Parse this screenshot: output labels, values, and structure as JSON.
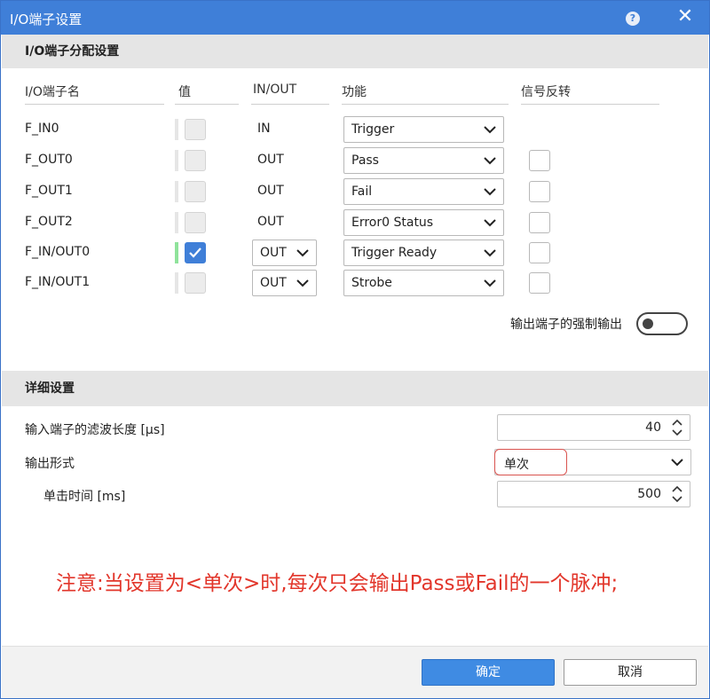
{
  "window": {
    "title": "I/O端子设置",
    "help_icon": "question-icon",
    "close_icon": "close-icon"
  },
  "section1": {
    "title": "I/O端子分配设置",
    "columns": [
      "I/O端子名",
      "值",
      "IN/OUT",
      "功能",
      "信号反转"
    ],
    "rows": [
      {
        "name": "F_IN0",
        "value_on": false,
        "io": "IN",
        "io_editable": false,
        "function": "Trigger",
        "invert_visible": false
      },
      {
        "name": "F_OUT0",
        "value_on": false,
        "io": "OUT",
        "io_editable": false,
        "function": "Pass",
        "invert_visible": true
      },
      {
        "name": "F_OUT1",
        "value_on": false,
        "io": "OUT",
        "io_editable": false,
        "function": "Fail",
        "invert_visible": true
      },
      {
        "name": "F_OUT2",
        "value_on": false,
        "io": "OUT",
        "io_editable": false,
        "function": "Error0 Status",
        "invert_visible": true
      },
      {
        "name": "F_IN/OUT0",
        "value_on": true,
        "io": "OUT",
        "io_editable": true,
        "function": "Trigger Ready",
        "invert_visible": true
      },
      {
        "name": "F_IN/OUT1",
        "value_on": false,
        "io": "OUT",
        "io_editable": true,
        "function": "Strobe",
        "invert_visible": true
      }
    ],
    "force_output_label": "输出端子的强制输出",
    "force_output_on": false
  },
  "section2": {
    "title": "详细设置",
    "filter_label": "输入端子的滤波长度 [μs]",
    "filter_value": "40",
    "output_form_label": "输出形式",
    "output_form_value": "单次",
    "single_time_label": "单击时间 [ms]",
    "single_time_value": "500"
  },
  "note": "注意:当设置为<单次>时,每次只会输出Pass或Fail的一个脉冲;",
  "buttons": {
    "ok": "确定",
    "cancel": "取消"
  },
  "colors": {
    "titlebar": "#3f7fd8",
    "note": "#e2362b",
    "active_value": "#8fe39b",
    "ok_button": "#3f8be3"
  }
}
